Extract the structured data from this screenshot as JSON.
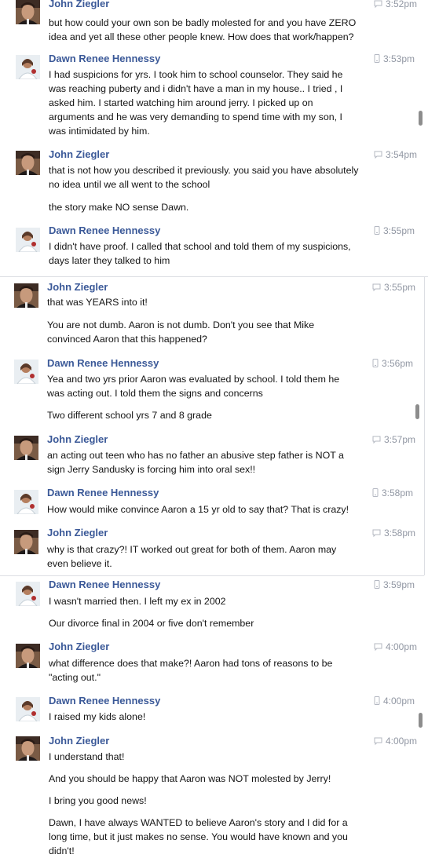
{
  "people": {
    "john": "John Ziegler",
    "dawn": "Dawn Renee Hennessy"
  },
  "messages": [
    {
      "sender": "John Ziegler",
      "time": "3:52pm",
      "lines": [
        "but how could your own son be badly molested for and you have ZERO",
        "idea and yet all these other people knew. How does that work/happen?"
      ]
    },
    {
      "sender": "Dawn Renee Hennessy",
      "time": "3:53pm",
      "lines": [
        "I had suspicions for yrs. I took him to school counselor. They said he",
        "was reaching puberty and i didn't have a man in my house.. I tried , I",
        "asked him. I started watching him around jerry. I picked up on",
        "arguments and he was very demanding to spend time with my son, I",
        "was intimidated by him."
      ]
    },
    {
      "sender": "John Ziegler",
      "time": "3:54pm",
      "lines": [
        "that is not how you described it previously. you said you have absolutely",
        "no idea until we all went to the school",
        "the story make NO sense Dawn."
      ]
    },
    {
      "sender": "Dawn Renee Hennessy",
      "time": "3:55pm",
      "lines": [
        "I didn't have proof. I called that school and told them of my suspicions,",
        "days later they talked to him"
      ]
    },
    {
      "sender": "John Ziegler",
      "time": "3:55pm",
      "lines": [
        "that was YEARS into it!",
        "You are not dumb. Aaron is not dumb. Don't you see that Mike",
        "convinced Aaron that this happened?"
      ]
    },
    {
      "sender": "Dawn Renee Hennessy",
      "time": "3:56pm",
      "lines": [
        "Yea and two yrs prior Aaron was evaluated by school. I told them he",
        "was acting out. I told them the signs and concerns",
        "Two different school yrs 7 and 8 grade"
      ]
    },
    {
      "sender": "John Ziegler",
      "time": "3:57pm",
      "lines": [
        "an acting out teen who has no father an abusive step father is NOT a",
        "sign Jerry Sandusky is forcing him into oral sex!!"
      ]
    },
    {
      "sender": "Dawn Renee Hennessy",
      "time": "3:58pm",
      "lines": [
        "How would mike convince Aaron a 15 yr old to say that? That is crazy!"
      ]
    },
    {
      "sender": "John Ziegler",
      "time": "3:58pm",
      "lines": [
        "why is that crazy?! IT worked out great for both of them. Aaron may",
        "even believe it."
      ]
    },
    {
      "sender": "Dawn Renee Hennessy",
      "time": "3:59pm",
      "lines": [
        "I wasn't married then. I left my ex in 2002",
        "Our divorce final in 2004 or five don't remember"
      ]
    },
    {
      "sender": "John Ziegler",
      "time": "4:00pm",
      "lines": [
        "what difference does that make?! Aaron had tons of reasons to be",
        "\"acting out.\""
      ]
    },
    {
      "sender": "Dawn Renee Hennessy",
      "time": "4:00pm",
      "lines": [
        "I raised my kids alone!"
      ]
    },
    {
      "sender": "John Ziegler",
      "time": "4:00pm",
      "lines": [
        "I understand that!",
        "And you should be happy that Aaron was NOT molested by Jerry!",
        "I bring you good news!",
        "Dawn, I have always WANTED to believe Aaron's story and I did for a",
        "long time, but it just makes no sense. You would have known and you",
        "didn't!"
      ]
    }
  ],
  "icons": {
    "web": "speech-bubble-icon",
    "mobile": "mobile-phone-icon"
  },
  "colors": {
    "name": "#3b5998",
    "time": "#9197a3",
    "text": "#141414"
  }
}
